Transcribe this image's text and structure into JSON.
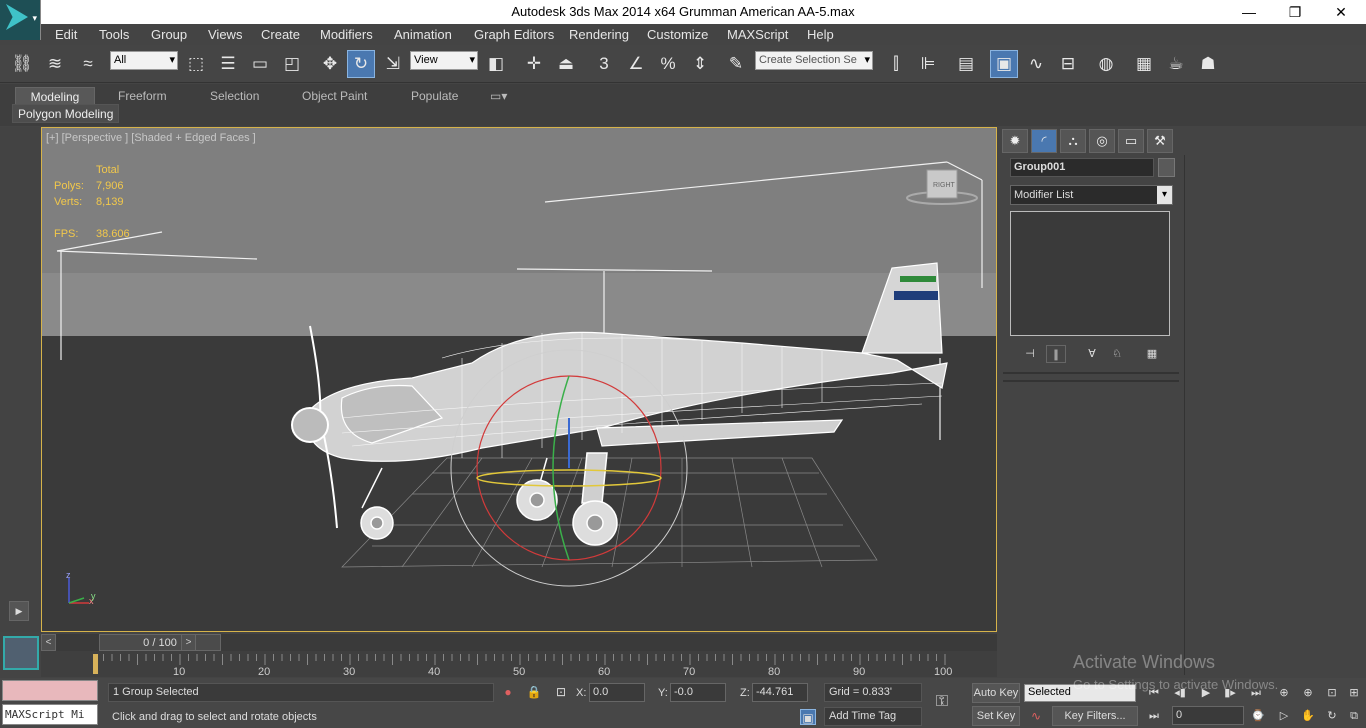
{
  "window": {
    "title": "Autodesk 3ds Max  2014 x64    Grumman American AA-5.max",
    "minimize": "—",
    "maximize": "❐",
    "close": "✕"
  },
  "menu": [
    "Edit",
    "Tools",
    "Group",
    "Views",
    "Create",
    "Modifiers",
    "Animation",
    "Graph Editors",
    "Rendering",
    "Customize",
    "MAXScript",
    "Help"
  ],
  "toolbar": {
    "selection_filter": "All",
    "reference_coord": "View",
    "named_selection_placeholder": "Create Selection Se",
    "snap_3": "3",
    "angle_snap": "∠",
    "percent_snap": "%"
  },
  "ribbon": {
    "tabs": [
      "Modeling",
      "Freeform",
      "Selection",
      "Object Paint",
      "Populate"
    ],
    "active_tab": "Modeling",
    "sub_panel": "Polygon Modeling"
  },
  "viewport": {
    "label": "[+] [Perspective ] [Shaded + Edged Faces ]",
    "stats_header": "Total",
    "polys_label": "Polys:",
    "polys": "7,906",
    "verts_label": "Verts:",
    "verts": "8,139",
    "fps_label": "FPS:",
    "fps": "38.606",
    "viewcube_label": "RIGHT",
    "axis_z": "z",
    "axis_x": "x",
    "axis_y": "y"
  },
  "command_panel": {
    "object_name": "Group001",
    "modifier_list": "Modifier List"
  },
  "timeline": {
    "frame": "0 / 100",
    "ticks": [
      "10",
      "20",
      "30",
      "40",
      "50",
      "60",
      "70",
      "80",
      "90",
      "100"
    ]
  },
  "status": {
    "selection_info": "1 Group Selected",
    "prompt": "Click and drag to select and rotate objects",
    "x_label": "X:",
    "x_value": "0.0",
    "y_label": "Y:",
    "y_value": "-0.0",
    "z_label": "Z:",
    "z_value": "-44.761",
    "grid": "Grid = 0.833'",
    "add_time_tag": "Add Time Tag",
    "maxscript": "MAXScript Mi",
    "auto_key": "Auto Key",
    "set_key": "Set Key",
    "key_mode": "Selected",
    "key_filters": "Key Filters...",
    "frame_field": "0"
  },
  "watermark": {
    "line1": "Activate Windows",
    "line2": "Go to Settings to activate Windows."
  }
}
